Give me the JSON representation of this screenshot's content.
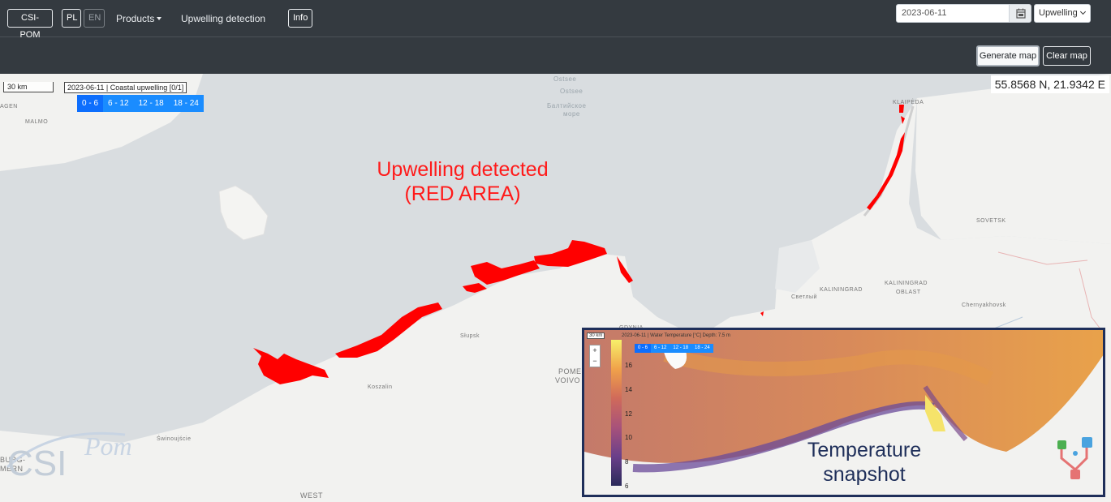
{
  "navbar": {
    "brand": "CSI-POM",
    "lang_pl": "PL",
    "lang_en": "EN",
    "products": "Products",
    "upwelling_link": "Upwelling detection",
    "info": "Info"
  },
  "controls": {
    "date": "2023-06-11",
    "product_select": "Upwelling",
    "generate": "Generate map",
    "clear": "Clear map"
  },
  "map": {
    "scale": "30 km",
    "legend_title": "2023-06-11 | Coastal upwelling [0/1]",
    "time_ranges": [
      "0 - 6",
      "6 - 12",
      "12 - 18",
      "18 - 24"
    ],
    "coords": "55.8568 N, 21.9342 E",
    "labels": {
      "ostsee1": "Ostsee",
      "ostsee2": "Ostsee",
      "baltic_ru": "Балтийское",
      "more": "море",
      "malmo": "MALMO",
      "klaipeda": "KLAIPĖDA",
      "sovetsk": "SOVETSK",
      "kaliningrad": "KALININGRAD",
      "kaliningrad_oblast": "KALININGRAD",
      "oblast": "OBLAST",
      "svetly": "Светлый",
      "chernyakhovsk": "Chernyakhovsk",
      "slupsk": "Słupsk",
      "koszalin": "Koszalin",
      "swinoujscie": "Świnoujście",
      "pome": "POME",
      "voivo": "VOIVO",
      "gdynia": "GDYNIA",
      "west": "WEST",
      "agen": "AGEN",
      "burg": "BURG-",
      "mern": "MERN"
    },
    "annotation_red_line1": "Upwelling detected",
    "annotation_red_line2": "(RED AREA)",
    "upwelling_color": "#ff0000"
  },
  "inset": {
    "scale": "30 km",
    "title": "2023-06-11 | Water Temperature [°C] Depth: 7.5 m",
    "time_ranges": [
      "0 - 6",
      "6 - 12",
      "12 - 18",
      "18 - 24"
    ],
    "ticks": [
      "16",
      "14",
      "12",
      "10",
      "8",
      "6"
    ],
    "zoom_in": "+",
    "zoom_out": "−",
    "annotation_line1": "Temperature",
    "annotation_line2": "snapshot"
  },
  "logo": {
    "text": "CSI",
    "script": "Pom"
  }
}
